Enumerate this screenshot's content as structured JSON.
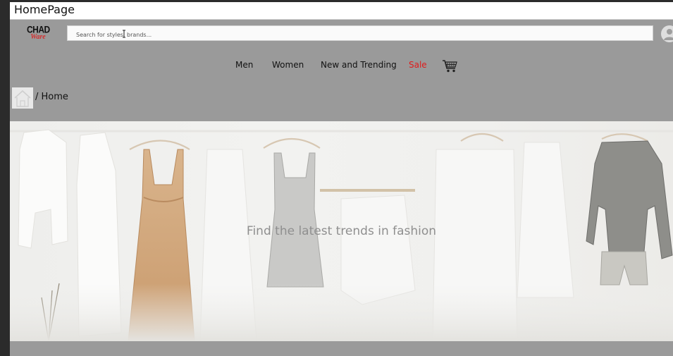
{
  "window": {
    "title": "HomePage"
  },
  "brand": {
    "line1": "CHAD",
    "line2": "Ware"
  },
  "search": {
    "placeholder": "Search for styles, brands..."
  },
  "nav": {
    "items": [
      {
        "label": "Men"
      },
      {
        "label": "Women"
      },
      {
        "label": "New and Trending"
      },
      {
        "label": "Sale"
      }
    ]
  },
  "breadcrumb": {
    "text": "/ Home"
  },
  "hero": {
    "tagline": "Find the latest trends in fashion"
  },
  "colors": {
    "frame_bg": "#9a9a9a",
    "sale": "#e01b1b",
    "logo_accent": "#d32f2f"
  },
  "icons": [
    "user-avatar-icon",
    "shopping-cart-icon",
    "home-icon",
    "text-cursor-icon"
  ]
}
